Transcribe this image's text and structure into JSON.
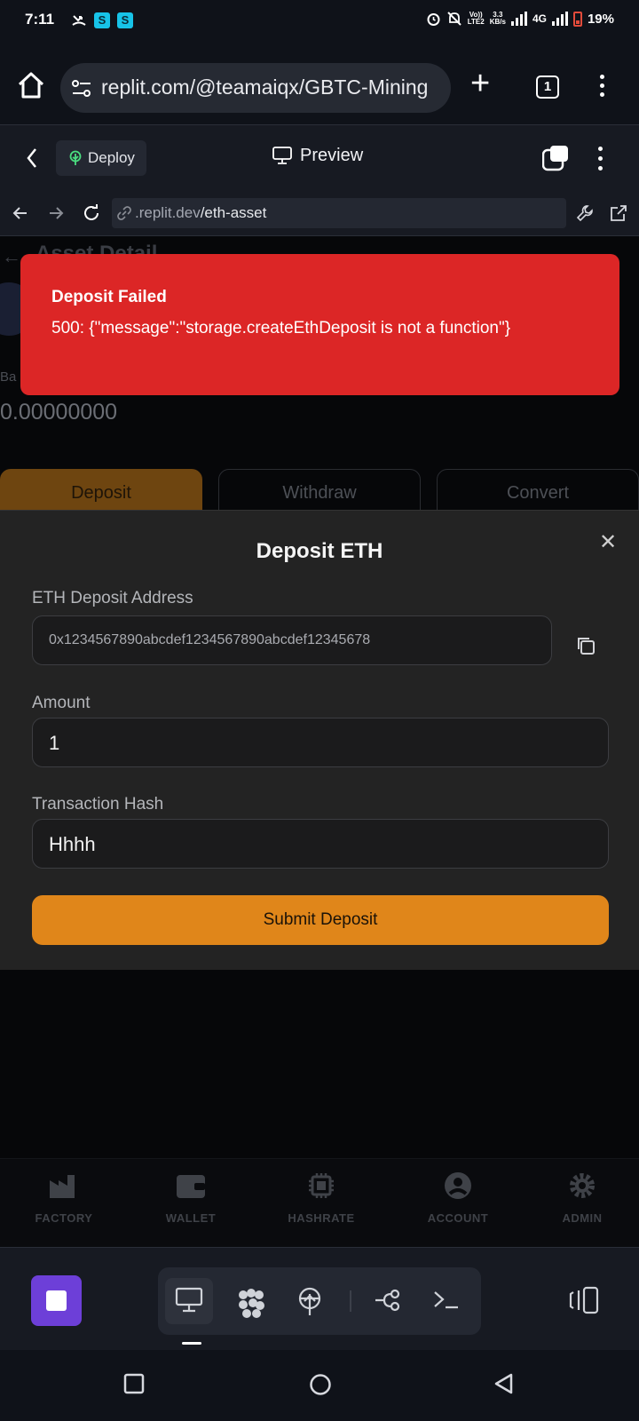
{
  "status_bar": {
    "time": "7:11",
    "volte": "Vo))\nLTE2",
    "speed": "3.3\nKB/s",
    "network": "4G",
    "battery": "19%"
  },
  "browser": {
    "url": "replit.com/@teamaiqx/GBTC-Mining",
    "tab_count": "1"
  },
  "replit_header": {
    "deploy_label": "Deploy",
    "preview_label": "Preview"
  },
  "inner_url": {
    "domain": ".replit.dev",
    "path": "/eth-asset"
  },
  "background_page": {
    "title": "Asset Detail",
    "balance_label": "Ba",
    "balance": "0.00000000",
    "tabs": [
      {
        "label": "Deposit"
      },
      {
        "label": "Withdraw"
      },
      {
        "label": "Convert"
      }
    ]
  },
  "toast": {
    "title": "Deposit Failed",
    "message": "500: {\"message\":\"storage.createEthDeposit is not a function\"}"
  },
  "deposit_sheet": {
    "title": "Deposit ETH",
    "address_label": "ETH Deposit Address",
    "address_value": "0x1234567890abcdef1234567890abcdef12345678",
    "amount_label": "Amount",
    "amount_value": "1",
    "hash_label": "Transaction Hash",
    "hash_value": "Hhhh",
    "submit_label": "Submit Deposit"
  },
  "bottom_nav": [
    {
      "label": "FACTORY",
      "icon": "factory-icon"
    },
    {
      "label": "WALLET",
      "icon": "wallet-icon"
    },
    {
      "label": "HASHRATE",
      "icon": "chip-icon"
    },
    {
      "label": "ACCOUNT",
      "icon": "account-icon"
    },
    {
      "label": "ADMIN",
      "icon": "gear-icon"
    }
  ],
  "colors": {
    "toast_bg": "#dc2626",
    "accent_orange": "#e0861a",
    "stop_purple": "#6d3fd8"
  }
}
